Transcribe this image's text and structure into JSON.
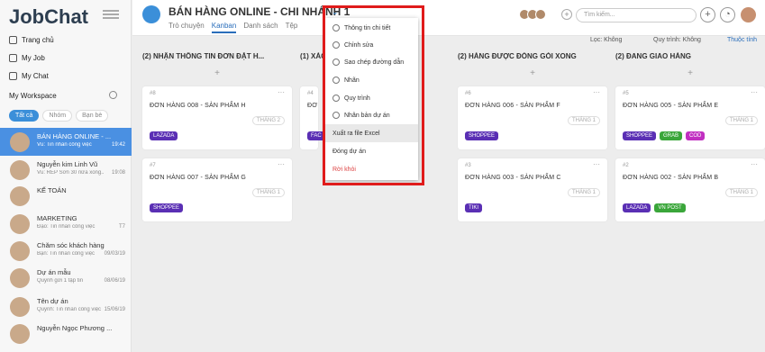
{
  "app": {
    "logo": "JobChat"
  },
  "sidebar": {
    "nav": [
      "Trang chủ",
      "My Job",
      "My Chat"
    ],
    "workspace_label": "My Workspace",
    "filters": [
      "Tất cả",
      "Nhóm",
      "Bạn bè"
    ],
    "chats": [
      {
        "name": "BÁN HÀNG ONLINE - ...",
        "sub": "Vũ: Tin nhắn công việc",
        "time": "19:42"
      },
      {
        "name": "Nguyễn kim Linh Vũ",
        "sub": "Vũ: REP Sơn 30 nửa xong...",
        "time": "19:08"
      },
      {
        "name": "KẾ TOÁN",
        "sub": "",
        "time": ""
      },
      {
        "name": "MARKETING",
        "sub": "Đạo: Tin nhắn công việc",
        "time": "T7"
      },
      {
        "name": "Chăm sóc khách hàng",
        "sub": "Bạn: Tin nhắn công việc",
        "time": "09/03/19"
      },
      {
        "name": "Dự án mẫu",
        "sub": "Quỳnh gửi 1 tập tin",
        "time": "08/06/19"
      },
      {
        "name": "Tên dự án",
        "sub": "Quỳnh: Tin nhắn công việc",
        "time": "15/06/19"
      },
      {
        "name": "Nguyễn Ngọc Phương ...",
        "sub": "",
        "time": ""
      }
    ]
  },
  "header": {
    "project_title": "BÁN HÀNG ONLINE - CHI NHÁNH 1",
    "tabs": [
      "Trò chuyện",
      "Kanban",
      "Danh sách",
      "Tệp"
    ],
    "search_placeholder": "Tìm kiếm..."
  },
  "subbar": {
    "filter": "Lọc: Không",
    "sort": "Quy trình: Không",
    "attr": "Thuộc tính"
  },
  "columns": [
    {
      "title": "(2) NHẬN THÔNG TIN ĐƠN ĐẶT H...",
      "cards": [
        {
          "num": "#8",
          "title": "ĐƠN HÀNG 008 - SẢN PHẨM H",
          "due": "THÁNG 2",
          "tags": [
            {
              "label": "LAZADA",
              "color": "#5a2fb4"
            }
          ]
        },
        {
          "num": "#7",
          "title": "ĐƠN HÀNG 007 - SẢN PHẨM G",
          "due": "THÁNG 1",
          "tags": [
            {
              "label": "SHOPPEE",
              "color": "#5a2fb4"
            }
          ]
        }
      ]
    },
    {
      "title": "(1) XÁC",
      "cards": [
        {
          "num": "#4",
          "title": "ĐƠ",
          "due": "",
          "tags": [
            {
              "label": "FAC",
              "color": "#5a2fb4"
            }
          ]
        }
      ]
    },
    {
      "title": "(2) HÀNG ĐƯỢC ĐÓNG GÓI XONG",
      "cards": [
        {
          "num": "#6",
          "title": "ĐƠN HÀNG 006 - SẢN PHẨM F",
          "due": "THÁNG 1",
          "tags": [
            {
              "label": "SHOPPEE",
              "color": "#5a2fb4"
            }
          ]
        },
        {
          "num": "#3",
          "title": "ĐƠN HÀNG 003 - SẢN PHẨM C",
          "due": "THÁNG 1",
          "tags": [
            {
              "label": "TIKI",
              "color": "#5a2fb4"
            }
          ]
        }
      ]
    },
    {
      "title": "(2) ĐANG GIAO HÀNG",
      "cards": [
        {
          "num": "#5",
          "title": "ĐƠN HÀNG 005 - SẢN PHẨM E",
          "due": "THÁNG 1",
          "tags": [
            {
              "label": "SHOPPEE",
              "color": "#5a2fb4"
            },
            {
              "label": "GRAB",
              "color": "#3aa63a"
            },
            {
              "label": "COD",
              "color": "#c12fc1"
            }
          ]
        },
        {
          "num": "#2",
          "title": "ĐƠN HÀNG 002 - SẢN PHẨM B",
          "due": "THÁNG 1",
          "tags": [
            {
              "label": "LAZADA",
              "color": "#5a2fb4"
            },
            {
              "label": "VN POST",
              "color": "#3aa63a"
            }
          ]
        }
      ]
    }
  ],
  "menu": [
    "Thông tin chi tiết",
    "Chỉnh sửa",
    "Sao chép đường dẫn",
    "Nhãn",
    "Quy trình",
    "Nhân bản dự án",
    "Xuất ra file Excel",
    "Đóng dự án",
    "Rời khỏi"
  ]
}
